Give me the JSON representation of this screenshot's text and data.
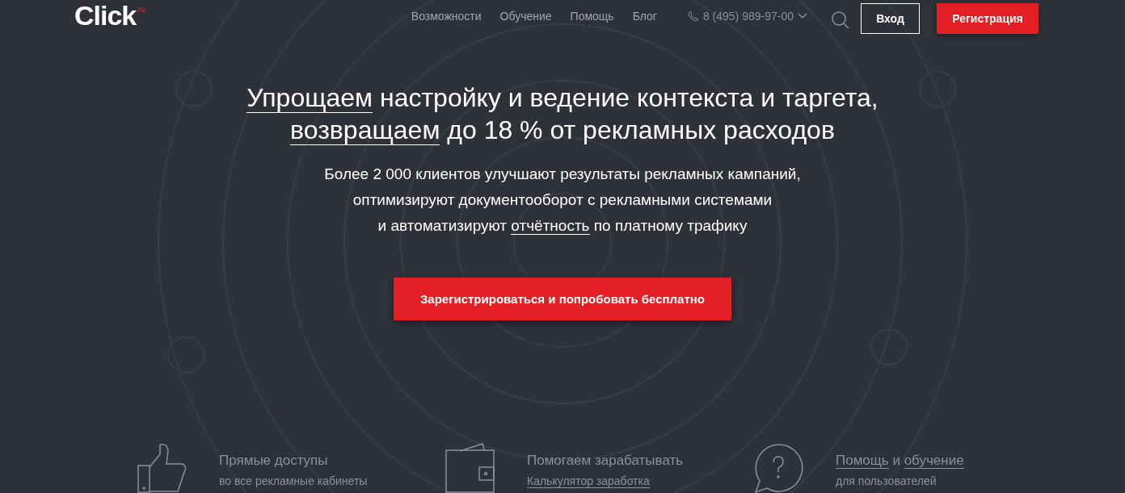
{
  "logo": {
    "text": "Click",
    "suffix": ".ru"
  },
  "nav": [
    {
      "label": "Возможности"
    },
    {
      "label": "Обучение"
    },
    {
      "label": "Помощь"
    },
    {
      "label": "Блог"
    }
  ],
  "phone": "8 (495) 989-97-00",
  "login_button": "Вход",
  "register_button": "Регистрация",
  "headline": [
    [
      {
        "text": "Упрощаем",
        "link": true
      },
      {
        "text": " настройку и ведение контекста и таргета,",
        "link": false
      }
    ],
    [
      {
        "text": "возвращаем",
        "link": true
      },
      {
        "text": " до 18 % от рекламных расходов",
        "link": false
      }
    ]
  ],
  "description": [
    [
      {
        "text": "Более 2 000 клиентов улучшают результаты рекламных кампаний,",
        "link": false
      }
    ],
    [
      {
        "text": "оптимизируют документооборот с рекламными системами",
        "link": false
      }
    ],
    [
      {
        "text": "и автоматизируют ",
        "link": false
      },
      {
        "text": "отчётность",
        "link": true
      },
      {
        "text": " по платному трафику",
        "link": false
      }
    ]
  ],
  "cta_button": "Зарегистрироваться и попробовать бесплатно",
  "features": [
    {
      "kind": "thumb",
      "title": [
        {
          "text": "Прямые доступы",
          "link": false
        }
      ],
      "subtitle": {
        "text": "во все рекламные кабинеты",
        "link": false
      }
    },
    {
      "kind": "wallet",
      "title": [
        {
          "text": "Помогаем зарабатывать",
          "link": false
        }
      ],
      "subtitle": {
        "text": "Калькулятор заработка",
        "link": true
      }
    },
    {
      "kind": "question",
      "title": [
        {
          "text": "Помощь",
          "link": true
        },
        {
          "text": " и ",
          "link": false
        },
        {
          "text": "обучение",
          "link": true
        }
      ],
      "subtitle": {
        "text": "для пользователей",
        "link": false
      }
    }
  ]
}
